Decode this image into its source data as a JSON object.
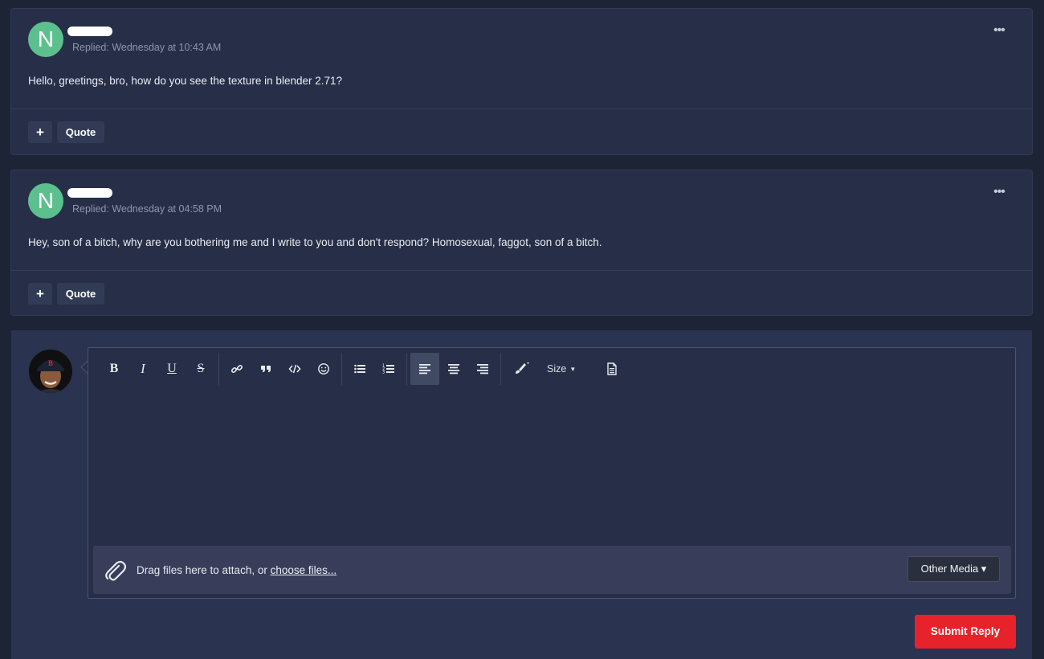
{
  "posts": [
    {
      "avatar_letter": "N",
      "timestamp": "Replied: Wednesday at 10:43 AM",
      "text": "Hello, greetings, bro, how do you see the texture in blender 2.71?",
      "more_label": "•••",
      "plus_label": "+",
      "quote_label": "Quote"
    },
    {
      "avatar_letter": "N",
      "timestamp": "Replied: Wednesday at 04:58 PM",
      "text": "Hey, son of a bitch, why are you bothering me and I write to you and don't respond? Homosexual, faggot, son of a bitch.",
      "more_label": "•••",
      "plus_label": "+",
      "quote_label": "Quote"
    }
  ],
  "editor": {
    "toolbar": {
      "bold": "B",
      "italic": "I",
      "underline": "U",
      "strike": "S",
      "size_label": "Size",
      "size_caret": "▼"
    },
    "attach": {
      "text": "Drag files here to attach, or ",
      "link": "choose files...",
      "other_media": "Other Media ▾"
    },
    "submit_label": "Submit Reply"
  },
  "colors": {
    "avatar_green": "#5cc08e",
    "submit_red": "#e7222a",
    "post_bg": "#262f47",
    "page_bg": "#1d2436"
  },
  "icons": [
    "more-icon",
    "plus-icon",
    "link-icon",
    "quote-icon",
    "code-icon",
    "smiley-icon",
    "bullet-list-icon",
    "numbered-list-icon",
    "align-left-icon",
    "align-center-icon",
    "align-right-icon",
    "brush-icon",
    "document-icon",
    "paperclip-icon"
  ]
}
